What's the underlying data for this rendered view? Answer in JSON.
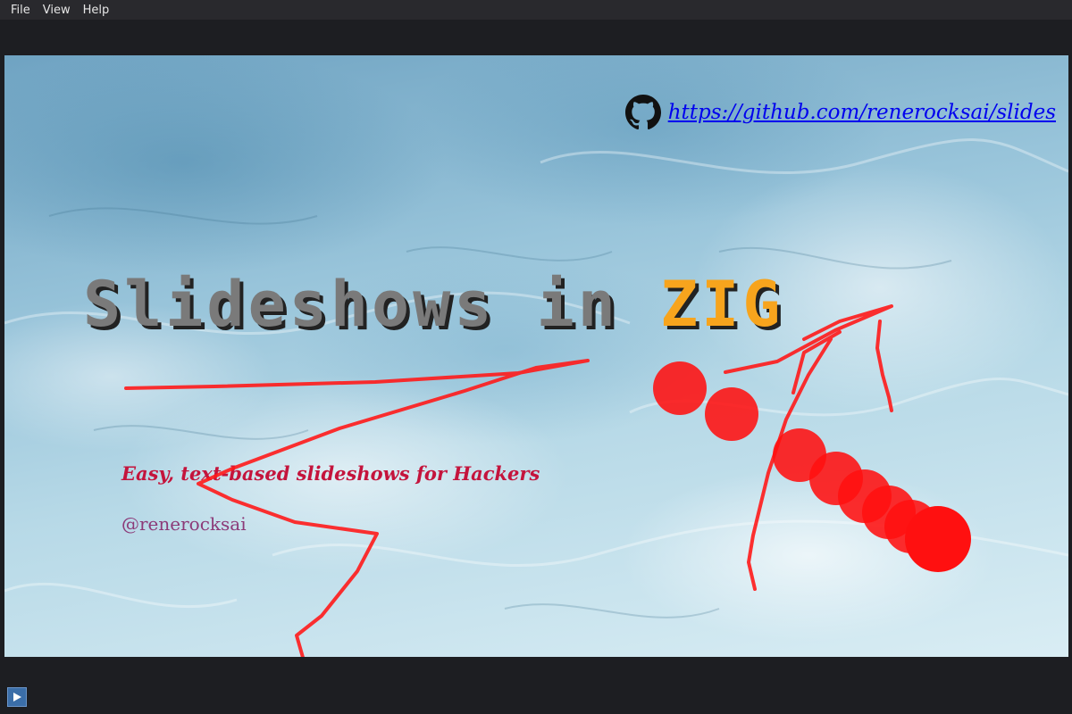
{
  "menubar": {
    "items": [
      {
        "label": "File"
      },
      {
        "label": "View"
      },
      {
        "label": "Help"
      }
    ]
  },
  "slide": {
    "link": {
      "text": "https://github.com/renerocksai/slides",
      "icon": "github-icon",
      "color": "#0000ee"
    },
    "title": {
      "main": "Slideshows in ",
      "highlight": "ZIG",
      "main_color": "#7a7a7a",
      "highlight_color": "#f7a41d"
    },
    "subtitle": "Easy, text-based slideshows for Hackers",
    "subtitle_color": "#c4143c",
    "author": "@renerocksai",
    "author_color": "#8c3a78"
  },
  "annotations": {
    "color": "#ff1a1a"
  },
  "toolbar": {
    "play_icon": "play-icon"
  }
}
